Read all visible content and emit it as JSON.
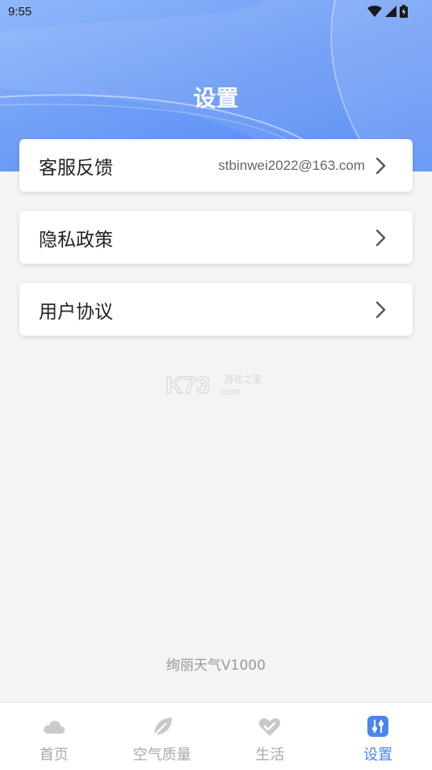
{
  "status_bar": {
    "time": "9:55"
  },
  "header": {
    "title": "设置"
  },
  "menu": [
    {
      "label": "客服反馈",
      "value": "stbinwei2022@163.com"
    },
    {
      "label": "隐私政策",
      "value": ""
    },
    {
      "label": "用户协议",
      "value": ""
    }
  ],
  "footer": {
    "version": "绚丽天气V1000"
  },
  "tabbar": [
    {
      "label": "首页",
      "icon": "cloud-icon"
    },
    {
      "label": "空气质量",
      "icon": "leaf-icon"
    },
    {
      "label": "生活",
      "icon": "heart-icon"
    },
    {
      "label": "设置",
      "icon": "settings-icon",
      "active": true
    }
  ],
  "colors": {
    "accent": "#4a86f0",
    "inactive": "#a9a9a9"
  }
}
